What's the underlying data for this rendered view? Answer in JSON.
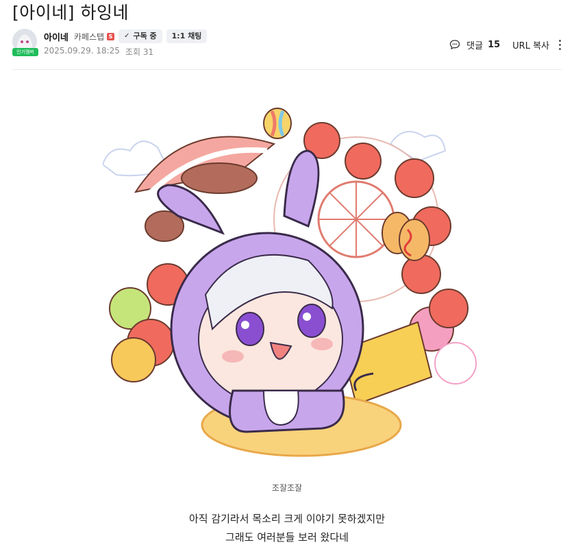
{
  "post": {
    "title": "[아이네] 하잉네",
    "author": {
      "name": "아이네",
      "level": "카페스탭",
      "grade_badge": "S",
      "popular_badge": "인기멤버"
    },
    "buttons": {
      "subscribe_label": "구독 중",
      "chat_label": "1:1 채팅"
    },
    "meta": {
      "date": "2025.09.29. 18:25",
      "views": "조회 31"
    },
    "actions": {
      "comment_label": "댓글",
      "comment_count": "15",
      "url_copy_label": "URL 복사"
    },
    "image": {
      "caption": "조잘조잘"
    },
    "body": {
      "line1": "아직 감기라서 목소리 크게 이야기 못하겠지만",
      "line2": "그래도 여러분들 보러 왔다네"
    }
  },
  "icons": [
    "comment-icon",
    "check-icon",
    "more-icon"
  ],
  "colors": {
    "popular_badge": "#1fbd5a",
    "grade_badge": "#e8534f",
    "pill_bg": "#eef0f3"
  }
}
